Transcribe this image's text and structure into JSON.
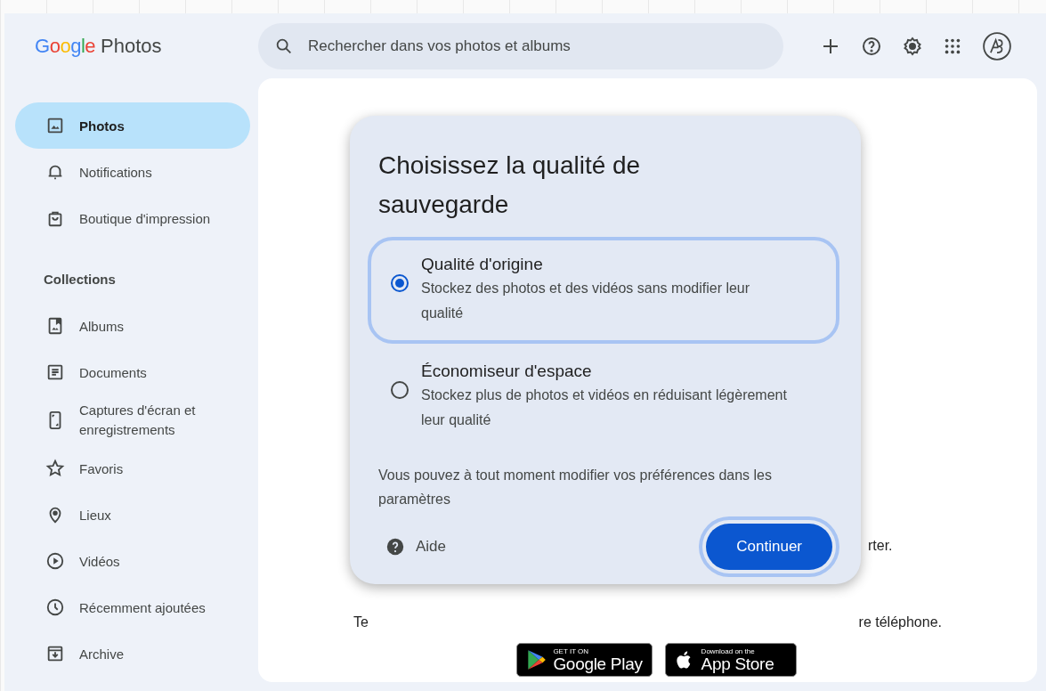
{
  "header": {
    "logo": {
      "brand": "Google",
      "product": "Photos"
    },
    "search": {
      "placeholder": "Rechercher dans vos photos et albums"
    }
  },
  "sidebar": {
    "items": [
      {
        "label": "Photos",
        "selected": true
      },
      {
        "label": "Notifications",
        "selected": false
      },
      {
        "label": "Boutique d'impression",
        "selected": false
      }
    ],
    "collections": {
      "heading": "Collections",
      "items": [
        {
          "label": "Albums",
          "selected": false
        },
        {
          "label": "Documents",
          "selected": false
        },
        {
          "label": "Captures d'écran et enregistrements",
          "selected": false
        },
        {
          "label": "Favoris",
          "selected": false
        },
        {
          "label": "Lieux",
          "selected": false
        },
        {
          "label": "Vidéos",
          "selected": false
        },
        {
          "label": "Récemment ajoutées",
          "selected": false
        },
        {
          "label": "Archive",
          "selected": false
        }
      ]
    }
  },
  "content": {
    "fragment_1": "rter.",
    "fragment_2": "Te",
    "fragment_3": "re téléphone.",
    "store_badges": [
      {
        "small": "GET IT ON",
        "large": "Google Play"
      },
      {
        "small": "Download on the",
        "large": "App Store"
      }
    ]
  },
  "dialog": {
    "title": "Choisissez la qualité de sauvegarde",
    "options": [
      {
        "title": "Qualité d'origine",
        "description": "Stockez des photos et des vidéos sans modifier leur qualité",
        "selected": true
      },
      {
        "title": "Économiseur d'espace",
        "description": "Stockez plus de photos et vidéos en réduisant légèrement leur qualité",
        "selected": false
      }
    ],
    "note": "Vous pouvez à tout moment modifier vos préférences dans les paramètres",
    "help": "Aide",
    "primary_button": "Continuer"
  }
}
